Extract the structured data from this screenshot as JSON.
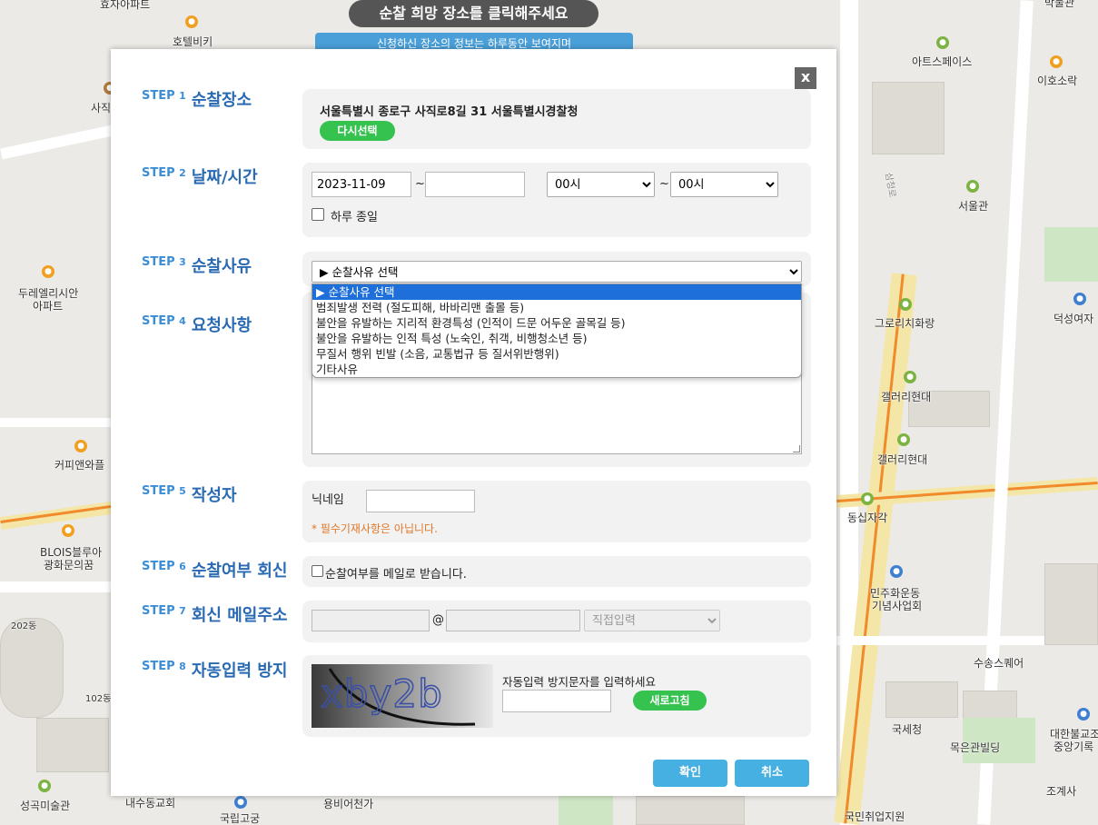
{
  "map": {
    "banner": "순찰 희망 장소를 클릭해주세요",
    "banner_sub": "신청하신 장소의 정보는 하루동안 보여지며",
    "labels": {
      "l1": "효자아파트",
      "l2": "호텔비키",
      "l3": "사직",
      "l4": "두레엘리시안",
      "l4b": "아파트",
      "l5": "커피앤와플",
      "l6": "BLOIS블루아",
      "l6b": "광화문의꿈",
      "l7": "202동",
      "l8": "102동",
      "l9": "성곡미술관",
      "l10": "내수동교회",
      "l11": "국립고궁",
      "l12": "용비어천가",
      "r1": "아트스페이스",
      "r2": "이호소락",
      "r3": "서울관",
      "r4": "그로리치화랑",
      "r5": "덕성여자",
      "r6": "갤러리현대",
      "r7": "갤러리현대",
      "r8": "동십자각",
      "r9": "민주화운동",
      "r9b": "기념사업회",
      "r10": "수송스퀘어",
      "r11": "국세청",
      "r12": "목은관빌딩",
      "r13": "대한불교조",
      "r13b": "중앙기록",
      "r14": "조계사",
      "r15": "국민취업지원",
      "r16": "박물관",
      "r17": "삼청로"
    }
  },
  "dialog": {
    "close_label": "x",
    "steps": [
      {
        "no": "STEP",
        "num": "1",
        "title": "순찰장소"
      },
      {
        "no": "STEP",
        "num": "2",
        "title": "날짜/시간"
      },
      {
        "no": "STEP",
        "num": "3",
        "title": "순찰사유"
      },
      {
        "no": "STEP",
        "num": "4",
        "title": "요청사항"
      },
      {
        "no": "STEP",
        "num": "5",
        "title": "작성자"
      },
      {
        "no": "STEP",
        "num": "6",
        "title": "순찰여부 회신"
      },
      {
        "no": "STEP",
        "num": "7",
        "title": "회신 메일주소"
      },
      {
        "no": "STEP",
        "num": "8",
        "title": "자동입력 방지"
      }
    ],
    "place": {
      "address": "서울특별시 종로구 사직로8길 31 서울특별시경찰청",
      "reselect_label": "다시선택"
    },
    "datetime": {
      "start_date": "2023-11-09",
      "end_date": "",
      "tilde": "~",
      "start_hour": "00시",
      "end_hour": "00시",
      "allday_label": "하루 종일"
    },
    "reason": {
      "selected": "▶ 순찰사유 선택",
      "options": [
        "▶ 순찰사유 선택",
        "범죄발생 전력 (절도피해, 바바리맨 출몰 등)",
        "불안을 유발하는 지리적 환경특성 (인적이 드문 어두운 골목길 등)",
        "불안을 유발하는 인적 특성 (노숙인, 취객, 비행청소년 등)",
        "무질서 행위 빈발 (소음, 교통법규 등 질서위반행위)",
        "기타사유"
      ]
    },
    "writer": {
      "nickname_label": "닉네임",
      "nickname_value": "",
      "note": "* 필수기재사항은 아닙니다."
    },
    "reply": {
      "label": "순찰여부를 메일로 받습니다."
    },
    "email": {
      "id": "",
      "at": "@",
      "domain": "",
      "domain_select": "직접입력"
    },
    "captcha": {
      "text": "xby2b",
      "prompt": "자동입력 방지문자를 입력하세요",
      "input_value": "",
      "refresh_label": "새로고침"
    },
    "confirm_label": "확인",
    "cancel_label": "취소"
  }
}
